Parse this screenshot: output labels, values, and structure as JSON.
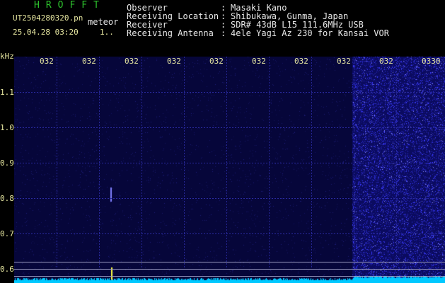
{
  "header": {
    "app_title": "HROFFT",
    "file_name": "UT2504280320.pn",
    "mode": "meteor",
    "datetime": "25.04.28 03:20",
    "counter": "1..",
    "fields": [
      {
        "label": "Observer",
        "value": "Masaki Kano"
      },
      {
        "label": "Receiving Location",
        "value": "Shibukawa, Gunma, Japan"
      },
      {
        "label": "Receiver",
        "value": "SDR# 43dB L15 111.6MHz USB"
      },
      {
        "label": "Receiving Antenna",
        "value": "4ele Yagi Az 230 for Kansai VOR"
      }
    ],
    "colon": ":"
  },
  "axes": {
    "y_unit": "kHz",
    "y_ticks": [
      "1.1",
      "1.0",
      "0.9",
      "0.8",
      "0.7",
      "0.6"
    ],
    "x_ticks": [
      "032",
      "032",
      "032",
      "032",
      "032",
      "032",
      "032",
      "032",
      "032",
      "0330"
    ]
  },
  "colors": {
    "background": "#000000",
    "plot": "#06063a",
    "title_green": "#2ec52e",
    "label_yellow": "#e6e6a0",
    "spectrum": "#00c8ff",
    "noise": "#3a3aff",
    "echo": "#ffff40"
  }
}
